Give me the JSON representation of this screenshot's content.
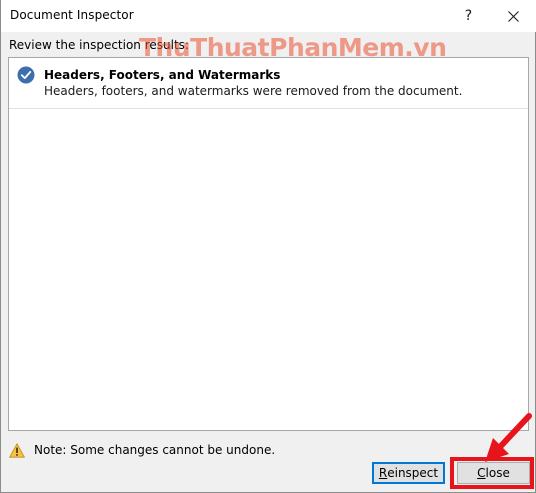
{
  "window": {
    "title": "Document Inspector",
    "help_label": "?"
  },
  "review_label": "Review the inspection results:",
  "watermark_text": "ThuThuatPhanMem.vn",
  "results": [
    {
      "title": "Headers, Footers, and Watermarks",
      "description": "Headers, footers, and watermarks were removed from the document.",
      "status_icon": "check-circle-icon"
    }
  ],
  "note": "Note: Some changes cannot be undone.",
  "buttons": {
    "reinspect_prefix": "R",
    "reinspect_rest": "einspect",
    "close_prefix": "C",
    "close_rest": "lose"
  },
  "colors": {
    "check_fill": "#3e6fad",
    "highlight": "#e8141b",
    "watermark": "#ec5032"
  }
}
